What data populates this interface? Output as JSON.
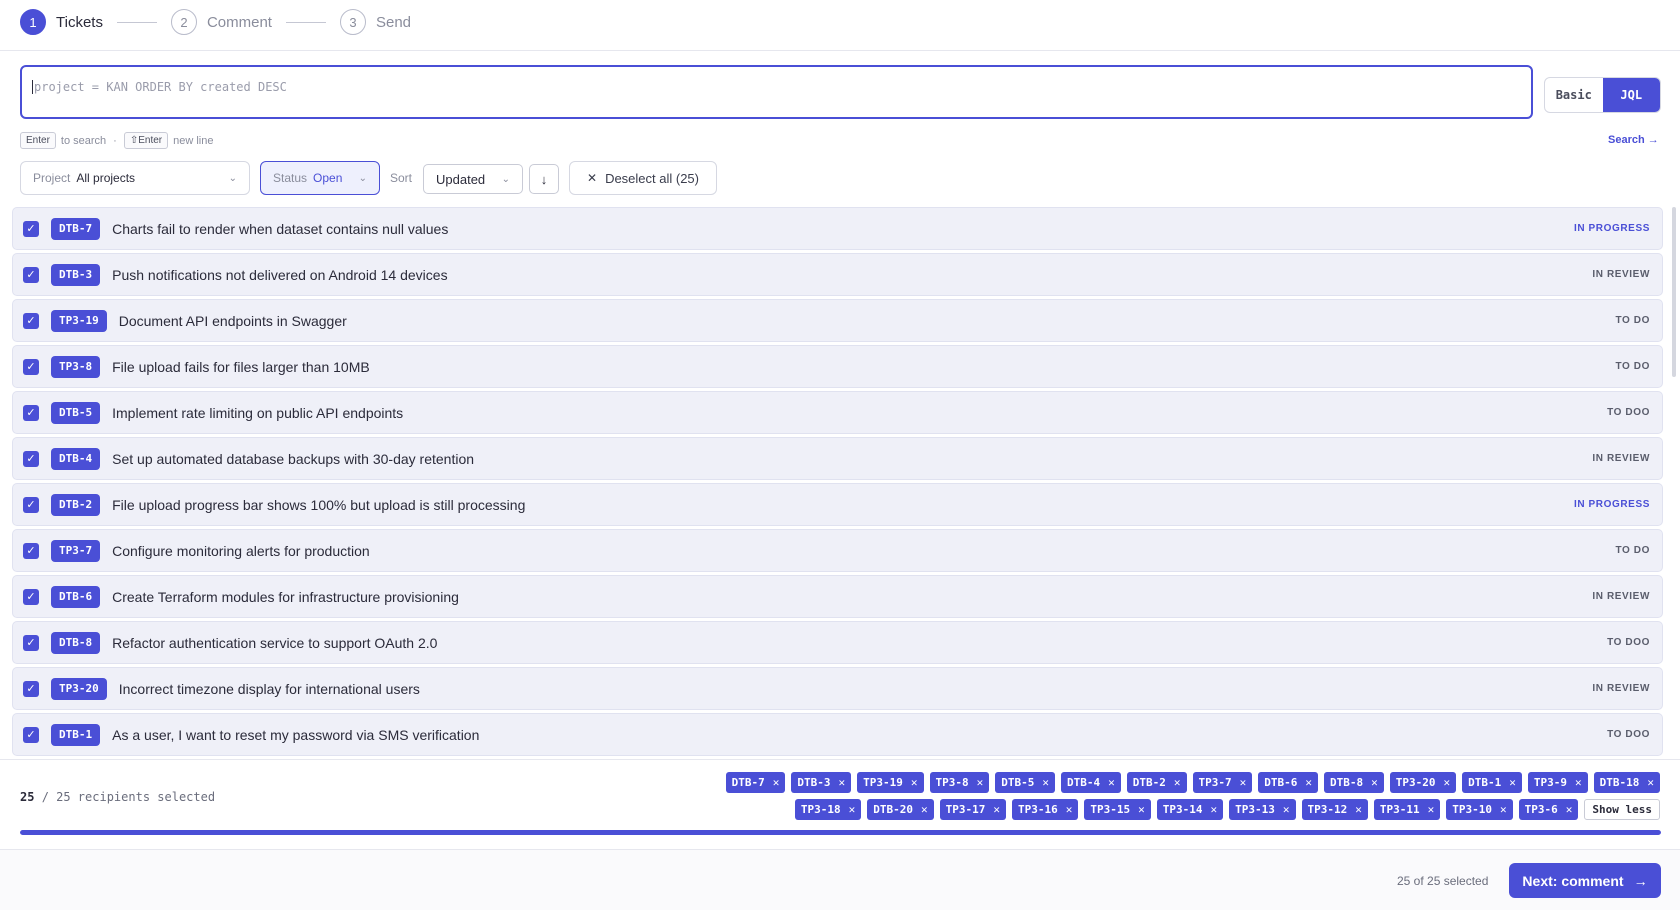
{
  "stepper": [
    {
      "num": "1",
      "label": "Tickets",
      "active": true
    },
    {
      "num": "2",
      "label": "Comment",
      "active": false
    },
    {
      "num": "3",
      "label": "Send",
      "active": false
    }
  ],
  "query": {
    "placeholder": "project = KAN ORDER BY created DESC"
  },
  "mode": {
    "basic": "Basic",
    "jql": "JQL",
    "selected": "JQL"
  },
  "hint": {
    "enter_key": "Enter",
    "enter_text": "to search",
    "sep": "·",
    "shift_key": "⇧Enter",
    "shift_text": "new line"
  },
  "search_link": "Search →",
  "filters": {
    "project": {
      "label": "Project",
      "value": "All projects"
    },
    "status": {
      "label": "Status",
      "value": "Open"
    },
    "sort": {
      "label": "Sort",
      "value": "Updated",
      "direction_icon": "↓"
    },
    "deselect": "Deselect all (25)"
  },
  "tickets": [
    {
      "key": "DTB-7",
      "title": "Charts fail to render when dataset contains null values",
      "status": "IN PROGRESS"
    },
    {
      "key": "DTB-3",
      "title": "Push notifications not delivered on Android 14 devices",
      "status": "IN REVIEW"
    },
    {
      "key": "TP3-19",
      "title": "Document API endpoints in Swagger",
      "status": "TO DO"
    },
    {
      "key": "TP3-8",
      "title": "File upload fails for files larger than 10MB",
      "status": "TO DO"
    },
    {
      "key": "DTB-5",
      "title": "Implement rate limiting on public API endpoints",
      "status": "TO DOO"
    },
    {
      "key": "DTB-4",
      "title": "Set up automated database backups with 30-day retention",
      "status": "IN REVIEW"
    },
    {
      "key": "DTB-2",
      "title": "File upload progress bar shows 100% but upload is still processing",
      "status": "IN PROGRESS"
    },
    {
      "key": "TP3-7",
      "title": "Configure monitoring alerts for production",
      "status": "TO DO"
    },
    {
      "key": "DTB-6",
      "title": "Create Terraform modules for infrastructure provisioning",
      "status": "IN REVIEW"
    },
    {
      "key": "DTB-8",
      "title": "Refactor authentication service to support OAuth 2.0",
      "status": "TO DOO"
    },
    {
      "key": "TP3-20",
      "title": "Incorrect timezone display for international users",
      "status": "IN REVIEW"
    },
    {
      "key": "DTB-1",
      "title": "As a user, I want to reset my password via SMS verification",
      "status": "TO DOO"
    }
  ],
  "selection": {
    "count": "25",
    "total_text": "/ 25 recipients selected",
    "chips": [
      "DTB-7",
      "DTB-3",
      "TP3-19",
      "TP3-8",
      "DTB-5",
      "DTB-4",
      "DTB-2",
      "TP3-7",
      "DTB-6",
      "DTB-8",
      "TP3-20",
      "DTB-1",
      "TP3-9",
      "DTB-18",
      "TP3-18",
      "DTB-20",
      "TP3-17",
      "TP3-16",
      "TP3-15",
      "TP3-14",
      "TP3-13",
      "TP3-12",
      "TP3-11",
      "TP3-10",
      "TP3-6"
    ],
    "show_less": "Show less",
    "progress": 1.0
  },
  "footer": {
    "count_text": "25 of 25 selected",
    "next_label": "Next: comment"
  },
  "colors": {
    "accent": "#4a4fd6"
  }
}
